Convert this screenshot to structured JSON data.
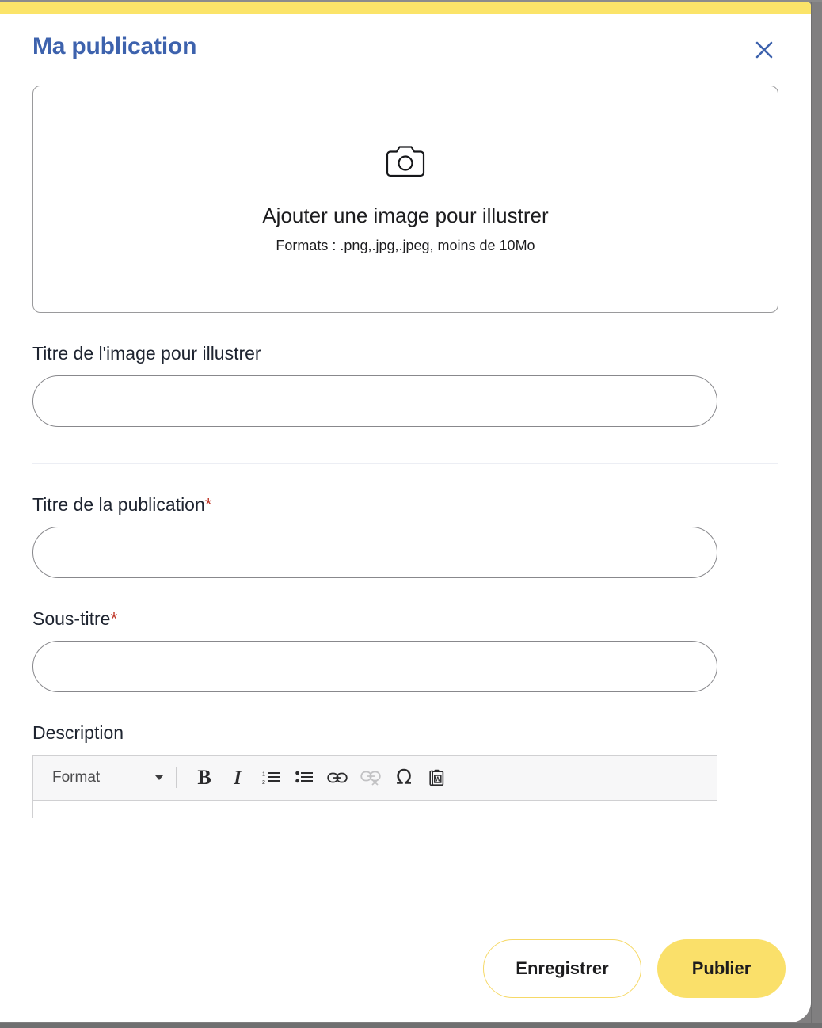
{
  "theme": {
    "accent_yellow": "#fbe469",
    "title_blue": "#3d62ad",
    "required_red": "#c0392b",
    "backdrop_gray": "#807f80"
  },
  "header": {
    "title": "Ma publication",
    "close_icon": "close-icon"
  },
  "dropzone": {
    "icon": "camera-icon",
    "title": "Ajouter une image pour illustrer",
    "subtitle": "Formats : .png,.jpg,.jpeg, moins de 10Mo"
  },
  "fields": {
    "image_title": {
      "label": "Titre de l'image pour illustrer",
      "value": "",
      "placeholder": "",
      "required": false
    },
    "publication_title": {
      "label": "Titre de la publication",
      "required_mark": "*",
      "value": "",
      "placeholder": "",
      "required": true
    },
    "subtitle": {
      "label": "Sous-titre",
      "required_mark": "*",
      "value": "",
      "placeholder": "",
      "required": true
    },
    "description": {
      "label": "Description",
      "value": ""
    }
  },
  "editor_toolbar": {
    "format_label": "Format",
    "format_caret": "chevron-down-icon",
    "buttons": [
      {
        "name": "bold-button",
        "glyph": "B",
        "disabled": false
      },
      {
        "name": "italic-button",
        "glyph": "I",
        "disabled": false
      },
      {
        "name": "numbered-list-button",
        "glyph": "numbered-list-icon",
        "disabled": false
      },
      {
        "name": "bulleted-list-button",
        "glyph": "bulleted-list-icon",
        "disabled": false
      },
      {
        "name": "link-button",
        "glyph": "link-icon",
        "disabled": false
      },
      {
        "name": "unlink-button",
        "glyph": "unlink-icon",
        "disabled": true
      },
      {
        "name": "special-character-button",
        "glyph": "Ω",
        "disabled": false
      },
      {
        "name": "paste-from-word-button",
        "glyph": "paste-word-icon",
        "disabled": false
      }
    ]
  },
  "footer": {
    "save_label": "Enregistrer",
    "publish_label": "Publier"
  }
}
